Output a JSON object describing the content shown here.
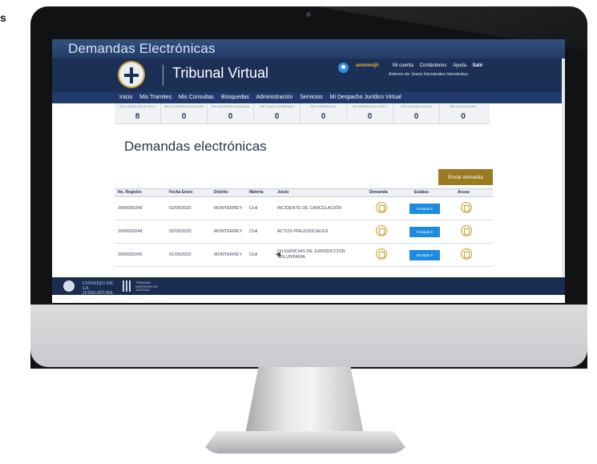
{
  "corner_text": "s",
  "app": {
    "window_title": "Demandas Electrónicas",
    "brand": "Tribunal Virtual"
  },
  "user": {
    "username": "antonioijh",
    "links": [
      "Mi cuenta",
      "Contáctenos",
      "Ayuda",
      "Salir"
    ],
    "full_name": "Antonio de Jesús Hernández Hernández"
  },
  "nav": {
    "items": [
      "Inicio",
      "Mis Tramites",
      "Mis Consultas",
      "Búsquedas",
      "Administración",
      "Servicios",
      "Mi Despacho Jurídico Virtual"
    ]
  },
  "stats": [
    {
      "label": "Mis expedientes en turno",
      "value": "8"
    },
    {
      "label": "Mis expedientes archivados",
      "value": "0"
    },
    {
      "label": "Mis expedientes asignados",
      "value": "0"
    },
    {
      "label": "Mis Copias Certificadas",
      "value": "0"
    },
    {
      "label": "Mis notificaciones",
      "value": "0"
    },
    {
      "label": "Mis notificaciones UNFC",
      "value": "0"
    },
    {
      "label": "Mis mensajes nuevos",
      "value": "0"
    },
    {
      "label": "Mis colaboradores",
      "value": "0"
    }
  ],
  "page": {
    "title": "Demandas electrónicas",
    "send_button": "Enviar demanda"
  },
  "table": {
    "headers": [
      "No. Registro",
      "Fecha Envío",
      "Distrito",
      "Materia",
      "Juicio",
      "Demanda",
      "Estatus",
      "Acuse"
    ],
    "rows": [
      {
        "registro": "2000000249",
        "fecha": "02/05/2020",
        "distrito": "MONTERREY",
        "materia": "Civil",
        "juicio": "INCIDENTE DE CANCELACIÓN",
        "estatus": "Enviado ▾"
      },
      {
        "registro": "2000000248",
        "fecha": "02/05/2020",
        "distrito": "MONTERREY",
        "materia": "Civil",
        "juicio": "ACTOS PREJUDICIALES",
        "estatus": "Enviado ▾"
      },
      {
        "registro": "2000000240",
        "fecha": "01/05/2020",
        "distrito": "MONTERREY",
        "materia": "Civil",
        "juicio": "DILIGENCIAS DE JURISDICCION VOLUNTARIA",
        "estatus": "Enviado ▾"
      }
    ]
  },
  "footer": {
    "consejo": "CONSEJO DE LA JUDICATURA",
    "tsj": "TRIBUNAL SUPERIOR DE JUSTICIA"
  },
  "colors": {
    "header": "#1c2f55",
    "accent_gold": "#9a7b1f",
    "status_blue": "#1d8ce0"
  }
}
